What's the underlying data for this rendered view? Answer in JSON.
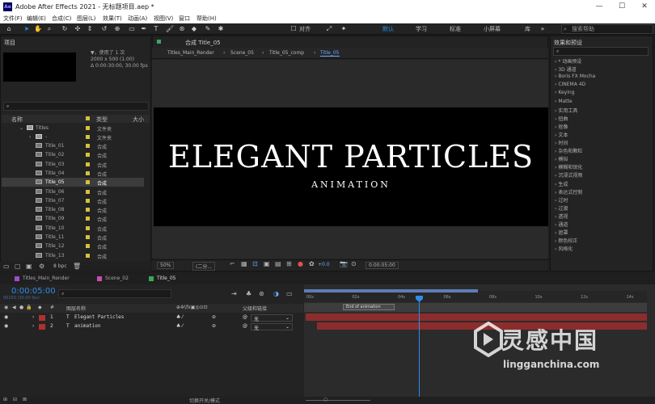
{
  "window": {
    "title": "Adobe After Effects 2021 - 无标题项目.aep *",
    "app_icon": "Ae"
  },
  "menu": [
    "文件(F)",
    "编辑(E)",
    "合成(C)",
    "图层(L)",
    "效果(T)",
    "动画(A)",
    "视图(V)",
    "窗口",
    "帮助(H)"
  ],
  "toolbar": {
    "align_label": "对齐",
    "workspaces": [
      "默认",
      "学习",
      "标准",
      "小屏幕",
      "库"
    ],
    "search_help_placeholder": "搜索帮助"
  },
  "project": {
    "title": "项目",
    "info": [
      "▼，使用了 1 次",
      "2000 x 500 (1.00)",
      "Δ 0:00:30:00, 30.00 fps"
    ],
    "columns": {
      "name": "名称",
      "type": "类型",
      "size": "大小"
    },
    "folder": {
      "name": "Titles",
      "type": "文件夹"
    },
    "subfolder": {
      "name": "-",
      "type": "文件夹"
    },
    "items": [
      {
        "name": "Title_01",
        "type": "合成"
      },
      {
        "name": "Title_02",
        "type": "合成"
      },
      {
        "name": "Title_03",
        "type": "合成"
      },
      {
        "name": "Title_04",
        "type": "合成"
      },
      {
        "name": "Title_05",
        "type": "合成"
      },
      {
        "name": "Title_06",
        "type": "合成"
      },
      {
        "name": "Title_07",
        "type": "合成"
      },
      {
        "name": "Title_08",
        "type": "合成"
      },
      {
        "name": "Title_09",
        "type": "合成"
      },
      {
        "name": "Title_10",
        "type": "合成"
      },
      {
        "name": "Title_11",
        "type": "合成"
      },
      {
        "name": "Title_12",
        "type": "合成"
      },
      {
        "name": "Title_13",
        "type": "合成"
      }
    ],
    "bpc": "8 bpc"
  },
  "composition": {
    "panel_title": "合成 Title_05",
    "breadcrumbs": [
      "Titles_Main_Render",
      "Scene_05",
      "Title_05_comp",
      "Title_05"
    ],
    "title_text": "ELEGANT PARTICLES",
    "subtitle_text": "ANIMATION",
    "zoom": "50%",
    "resolution": "(二分...",
    "exposure": "+0.0",
    "timecode": "0:00:05:00"
  },
  "effects": {
    "title": "效果和预设",
    "items": [
      "* 动画预设",
      "3D 通道",
      "Boris FX Mocha",
      "CINEMA 4D",
      "Keying",
      "Matte",
      "实用工具",
      "扭曲",
      "抠像",
      "文本",
      "时间",
      "杂色和颗粒",
      "模拟",
      "模糊和锐化",
      "沉浸式视频",
      "生成",
      "表达式控制",
      "过时",
      "过渡",
      "透视",
      "通道",
      "遮罩",
      "颜色校正",
      "风格化"
    ]
  },
  "timeline": {
    "tabs": [
      {
        "name": "Titles_Main_Render",
        "color": "#a04bd0"
      },
      {
        "name": "Scene_02",
        "color": "#c94db0"
      },
      {
        "name": "Title_05",
        "color": "#39a85b"
      }
    ],
    "timecode": "0:00:05:00",
    "fps": "00150 (30.00 fps)",
    "columns": {
      "source": "图层名称",
      "parent": "父级和链接"
    },
    "layers": [
      {
        "index": "1",
        "type": "T",
        "name": "Elegant Particles",
        "parent": "无"
      },
      {
        "index": "2",
        "type": "T",
        "name": "animation",
        "parent": "无"
      }
    ],
    "ruler": [
      "00s",
      "02s",
      "04s",
      "06s",
      "08s",
      "10s",
      "12s",
      "14s"
    ],
    "marker": "End of animation",
    "toggle_label": "切换开关/模式"
  },
  "watermark": {
    "main": "灵感中国",
    "url": "lingganchina.com"
  }
}
